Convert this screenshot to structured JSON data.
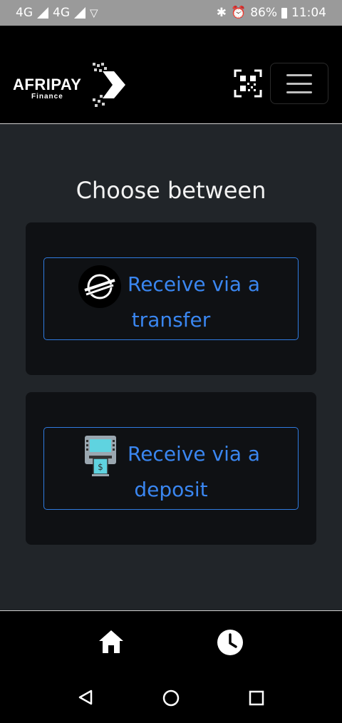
{
  "status_bar": {
    "network_1": "4G",
    "network_2": "4G",
    "battery": "86%",
    "time": "11:04"
  },
  "header": {
    "logo_text": "AFRIPAY",
    "logo_sub": "Finance",
    "qr_icon": "qr-code-scan-icon",
    "menu_icon": "hamburger-menu-icon"
  },
  "main": {
    "title": "Choose between",
    "options": [
      {
        "line1": "Receive via a",
        "line2": "transfer",
        "icon": "stellar-logo-icon"
      },
      {
        "line1": "Receive via a",
        "line2": "deposit",
        "icon": "atm-machine-icon"
      }
    ]
  },
  "bottom_nav": {
    "items": [
      {
        "icon": "home-icon"
      },
      {
        "icon": "history-clock-icon"
      }
    ]
  },
  "system_nav": {
    "items": [
      "back-triangle-icon",
      "home-circle-icon",
      "recents-square-icon"
    ]
  },
  "colors": {
    "accent": "#3a86f0",
    "page_bg": "#212529",
    "card_bg": "#0f1114",
    "header_bg": "#000000",
    "status_bar_bg": "#9a9a9a"
  }
}
